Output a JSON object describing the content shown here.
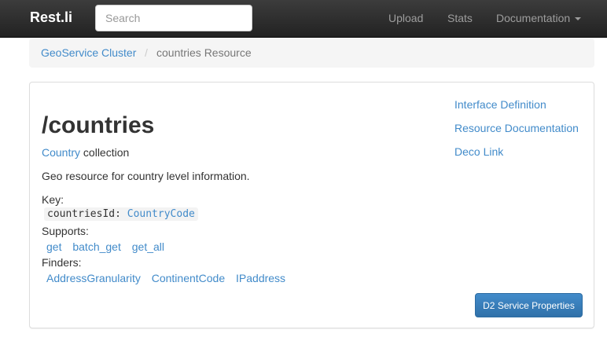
{
  "navbar": {
    "brand": "Rest.li",
    "search_placeholder": "Search",
    "links": [
      "Upload",
      "Stats",
      "Documentation"
    ]
  },
  "breadcrumb": {
    "parent": "GeoService Cluster",
    "separator": "/",
    "current": "countries Resource"
  },
  "resource": {
    "title": "/countries",
    "type_link": "Country",
    "type_suffix": "collection",
    "description": "Geo resource for country level information.",
    "key_label": "Key:",
    "key_name": "countriesId:",
    "key_type": "CountryCode",
    "supports_label": "Supports:",
    "supports": [
      "get",
      "batch_get",
      "get_all"
    ],
    "finders_label": "Finders:",
    "finders": [
      "AddressGranularity",
      "ContinentCode",
      "IPaddress"
    ]
  },
  "side_links": [
    "Interface Definition",
    "Resource Documentation",
    "Deco Link"
  ],
  "button": "D2 Service Properties"
}
